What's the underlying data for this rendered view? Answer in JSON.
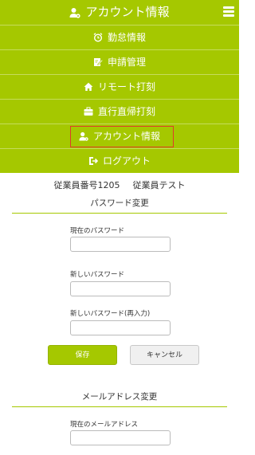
{
  "header": {
    "title": "アカウント情報",
    "icon": "user-gear-icon"
  },
  "menu": {
    "items": [
      {
        "label": "勤怠情報",
        "icon": "alarm-clock-icon"
      },
      {
        "label": "申請管理",
        "icon": "edit-document-icon"
      },
      {
        "label": "リモート打刻",
        "icon": "home-icon"
      },
      {
        "label": "直行直帰打刻",
        "icon": "briefcase-icon"
      },
      {
        "label": "アカウント情報",
        "icon": "user-gear-icon",
        "active": true
      },
      {
        "label": "ログアウト",
        "icon": "logout-icon"
      }
    ]
  },
  "employee": {
    "number_label": "従業員番号1205",
    "name": "従業員テスト"
  },
  "password_section": {
    "title": "パスワード変更",
    "current_label": "現在のパスワード",
    "new_label": "新しいパスワード",
    "confirm_label": "新しいパスワード(再入力)",
    "save_label": "保存",
    "cancel_label": "キャンセル"
  },
  "email_section": {
    "title": "メールアドレス変更",
    "current_label": "現在のメールアドレス"
  },
  "colors": {
    "accent": "#a5c800",
    "highlight_border": "#e03a2a"
  }
}
